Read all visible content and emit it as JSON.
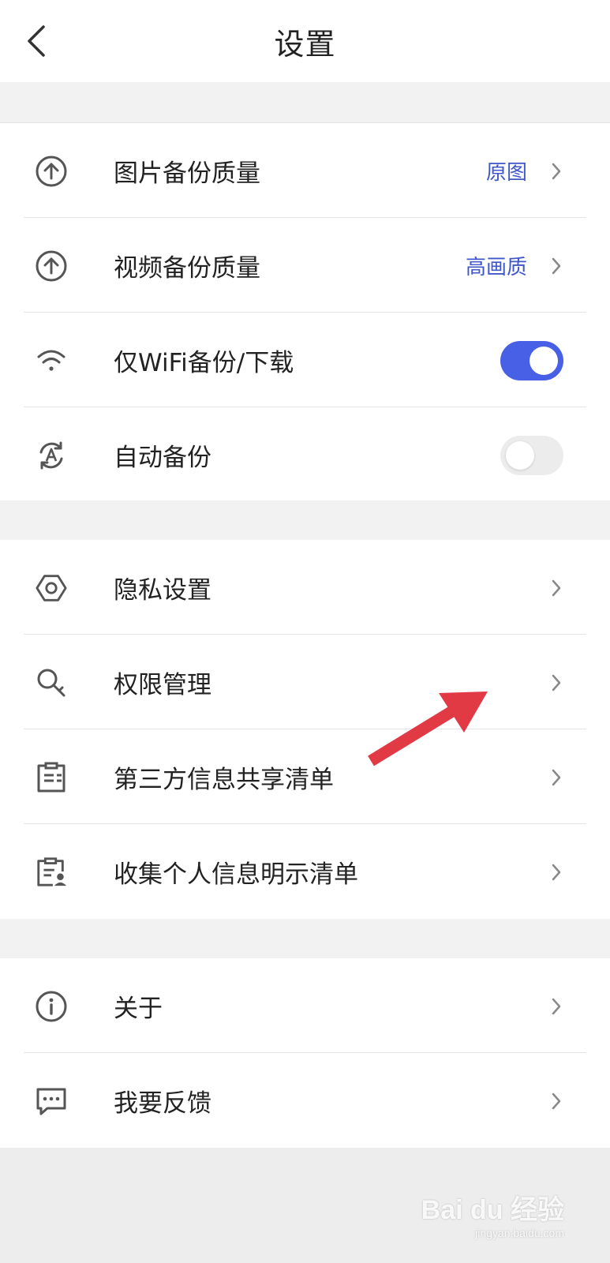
{
  "header": {
    "title": "设置"
  },
  "section1": {
    "items": [
      {
        "label": "图片备份质量",
        "value": "原图",
        "icon": "upload-circle-icon"
      },
      {
        "label": "视频备份质量",
        "value": "高画质",
        "icon": "upload-circle-icon"
      },
      {
        "label": "仅WiFi备份/下载",
        "toggle": "on",
        "icon": "wifi-icon"
      },
      {
        "label": "自动备份",
        "toggle": "off",
        "icon": "auto-sync-icon"
      }
    ]
  },
  "section2": {
    "items": [
      {
        "label": "隐私设置",
        "icon": "privacy-icon"
      },
      {
        "label": "权限管理",
        "icon": "key-icon"
      },
      {
        "label": "第三方信息共享清单",
        "icon": "clipboard-list-icon"
      },
      {
        "label": "收集个人信息明示清单",
        "icon": "clipboard-person-icon"
      }
    ]
  },
  "section3": {
    "items": [
      {
        "label": "关于",
        "icon": "info-icon"
      },
      {
        "label": "我要反馈",
        "icon": "feedback-icon"
      }
    ]
  },
  "colors": {
    "accent": "#4760e6",
    "value_text": "#3f57c8",
    "annotation_arrow": "#e23a45"
  },
  "watermark": {
    "brand": "Bai du 经验",
    "site": "jingyan.baidu.com"
  }
}
